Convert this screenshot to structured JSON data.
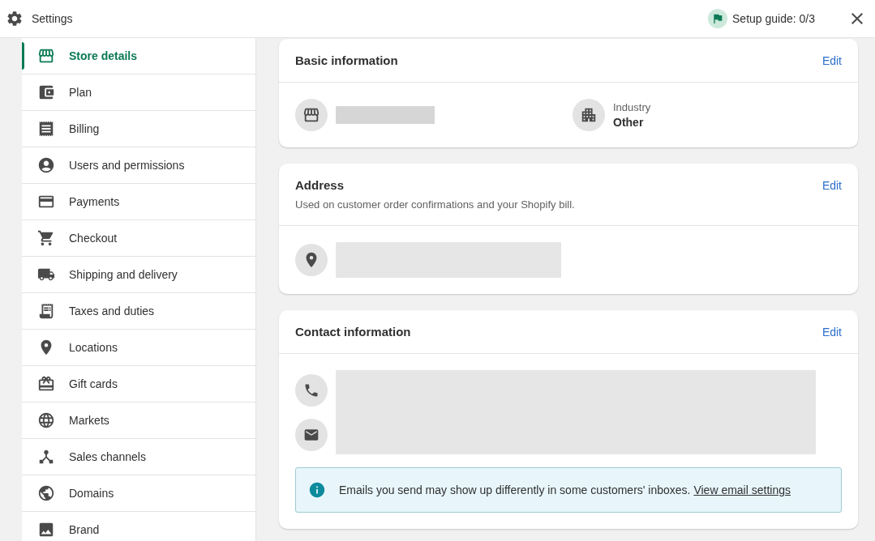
{
  "header": {
    "title": "Settings",
    "setup_guide": "Setup guide: 0/3"
  },
  "sidebar": {
    "items": [
      {
        "label": "Store details",
        "selected": true
      },
      {
        "label": "Plan",
        "selected": false
      },
      {
        "label": "Billing",
        "selected": false
      },
      {
        "label": "Users and permissions",
        "selected": false
      },
      {
        "label": "Payments",
        "selected": false
      },
      {
        "label": "Checkout",
        "selected": false
      },
      {
        "label": "Shipping and delivery",
        "selected": false
      },
      {
        "label": "Taxes and duties",
        "selected": false
      },
      {
        "label": "Locations",
        "selected": false
      },
      {
        "label": "Gift cards",
        "selected": false
      },
      {
        "label": "Markets",
        "selected": false
      },
      {
        "label": "Sales channels",
        "selected": false
      },
      {
        "label": "Domains",
        "selected": false
      },
      {
        "label": "Brand",
        "selected": false
      }
    ]
  },
  "basic_information": {
    "title": "Basic information",
    "edit": "Edit",
    "industry_label": "Industry",
    "industry_value": "Other"
  },
  "address": {
    "title": "Address",
    "edit": "Edit",
    "description": "Used on customer order confirmations and your Shopify bill."
  },
  "contact_information": {
    "title": "Contact information",
    "edit": "Edit",
    "banner": "Emails you send may show up differently in some customers' inboxes.",
    "banner_link": "View email settings"
  }
}
